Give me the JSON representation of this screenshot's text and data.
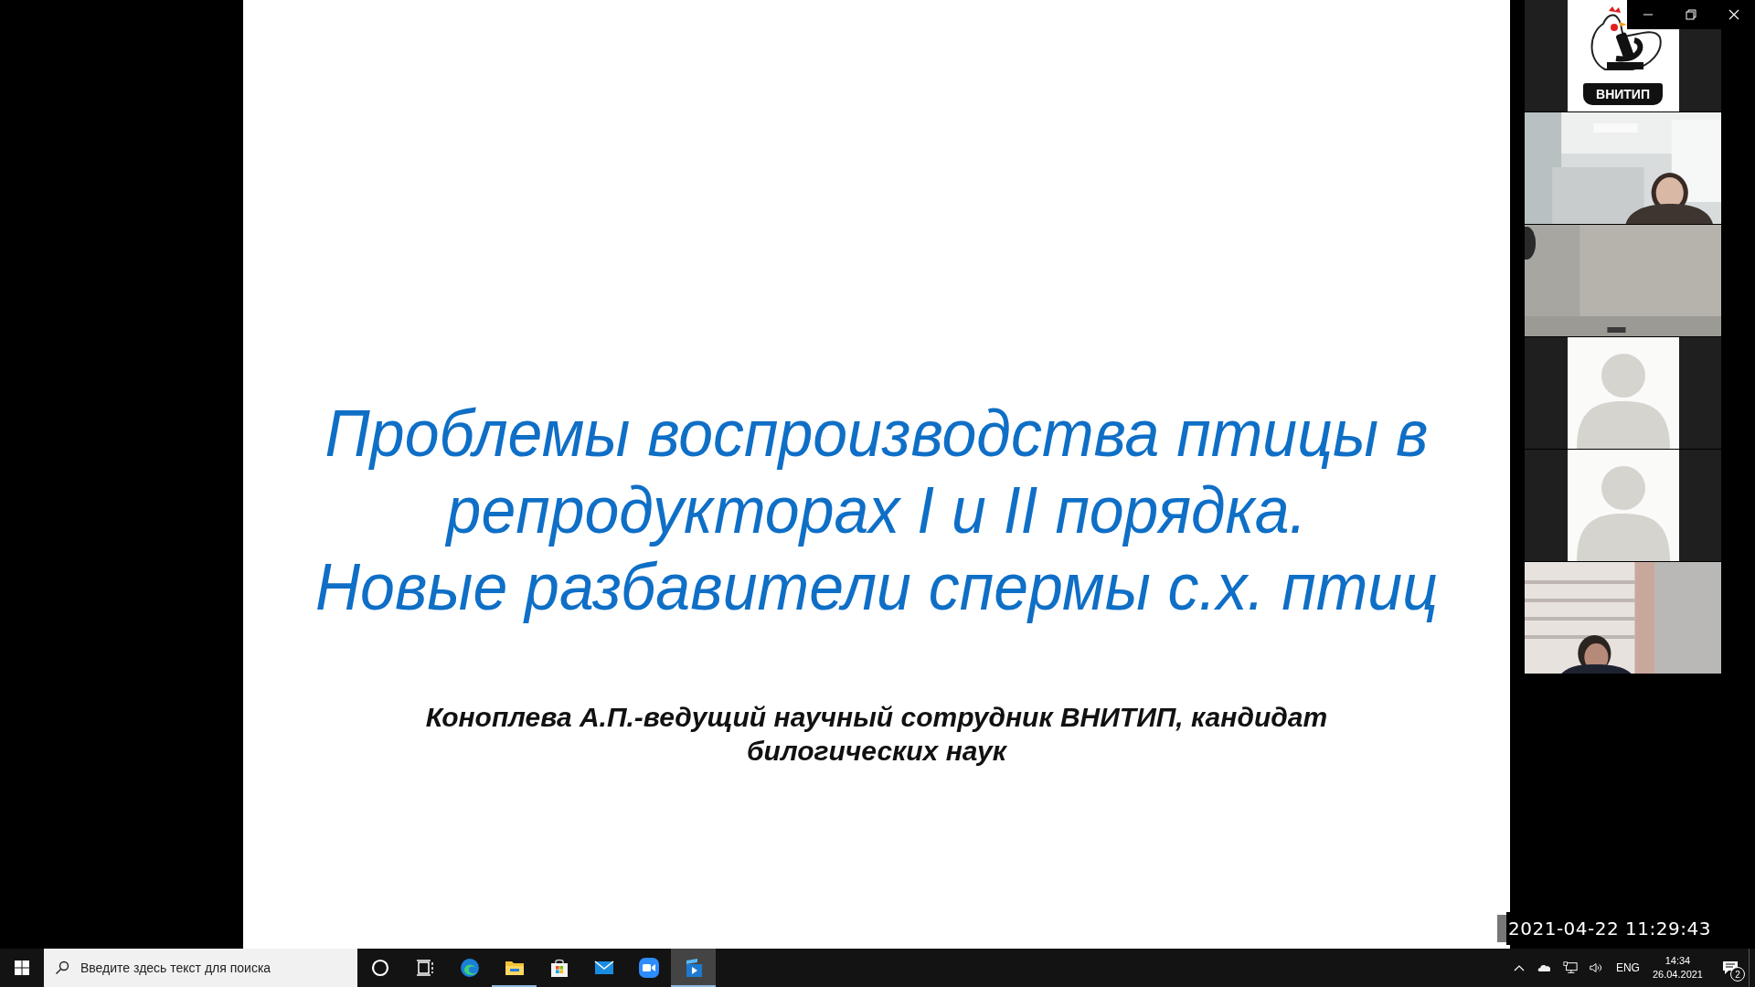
{
  "slide": {
    "title_lines": [
      "Проблемы воспроизводства птицы в",
      "репродукторах I и II порядка.",
      "Новые разбавители спермы с.х. птиц"
    ],
    "author_lines": [
      "Коноплева А.П.-ведущий научный сотрудник ВНИТИП, кандидат",
      "билогических наук"
    ]
  },
  "participants": [
    {
      "kind": "logo",
      "label": "ВНИТИП"
    },
    {
      "kind": "video"
    },
    {
      "kind": "video"
    },
    {
      "kind": "avatar"
    },
    {
      "kind": "avatar"
    },
    {
      "kind": "video"
    }
  ],
  "recording_timestamp": "2021-04-22 11:29:43",
  "taskbar": {
    "search": {
      "placeholder": "Введите здесь текст для поиска"
    },
    "apps": [
      {
        "kind": "cortana",
        "running": false,
        "selected": false
      },
      {
        "kind": "taskview",
        "running": false,
        "selected": false
      },
      {
        "kind": "edge",
        "running": false,
        "selected": false
      },
      {
        "kind": "explorer",
        "running": true,
        "selected": false
      },
      {
        "kind": "store",
        "running": false,
        "selected": false
      },
      {
        "kind": "mail",
        "running": false,
        "selected": false
      },
      {
        "kind": "zoom",
        "running": false,
        "selected": false
      },
      {
        "kind": "player",
        "running": true,
        "selected": true
      }
    ],
    "tray": {
      "language": "ENG",
      "time": "14:34",
      "date": "26.04.2021",
      "notifications": "2"
    }
  }
}
